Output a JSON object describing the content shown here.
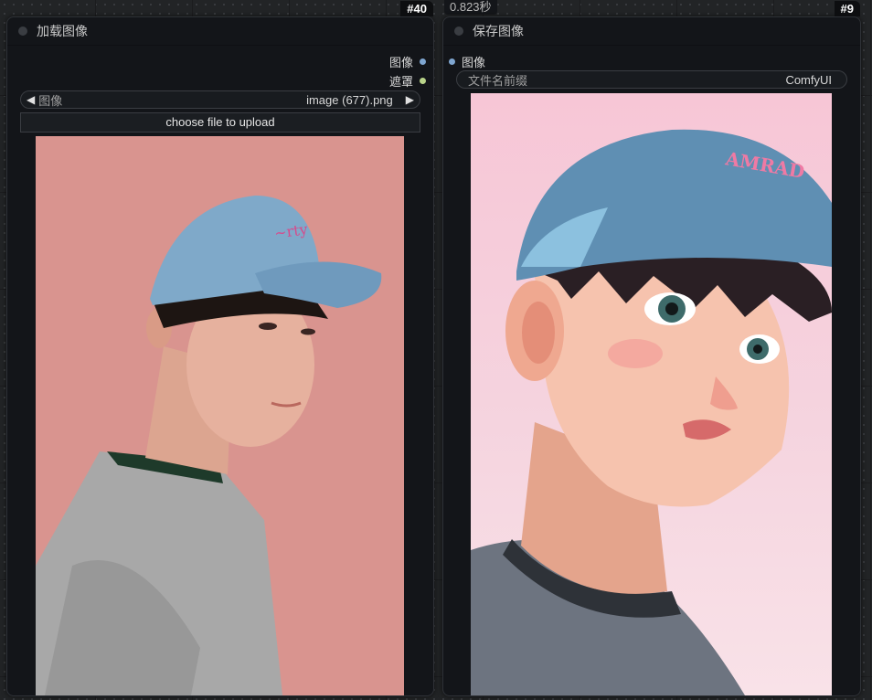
{
  "canvas": {
    "time_badge": "0.823秒"
  },
  "load_node": {
    "id_badge": "#40",
    "title": "加载图像",
    "outputs": [
      {
        "label": "图像",
        "color": "#7fa6d0"
      },
      {
        "label": "遮罩",
        "color": "#b9d48a"
      }
    ],
    "image_widget": {
      "label": "图像",
      "value": "image (677).png",
      "left_arrow": "◀",
      "right_arrow": "▶"
    },
    "upload_button": "choose file to upload",
    "preview_icon": "photo-preview-icon"
  },
  "save_node": {
    "id_badge": "#9",
    "title": "保存图像",
    "input": {
      "label": "图像",
      "color": "#7fa6d0"
    },
    "prefix_widget": {
      "label": "文件名前缀",
      "value": "ComfyUI"
    },
    "preview_icon": "anime-preview-icon",
    "cap_text": "AMRAD"
  }
}
